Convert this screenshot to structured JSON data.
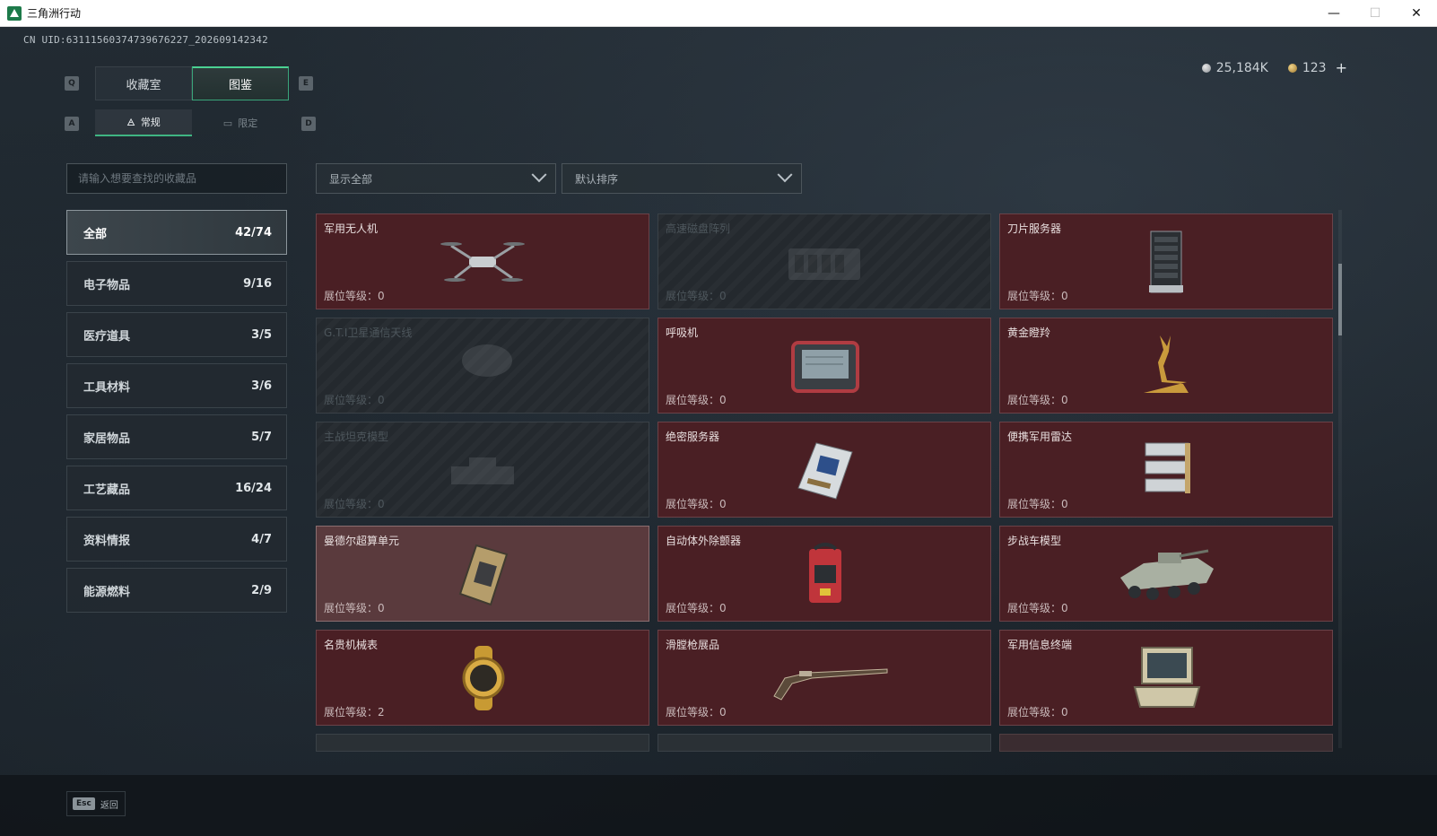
{
  "window": {
    "title": "三角洲行动",
    "minimize": "—",
    "maximize": "☐",
    "close": "✕"
  },
  "uid": "CN UID:6311156037473967622​7_202609142342",
  "currency": {
    "silver": "25,184K",
    "gold": "123",
    "plus": "+"
  },
  "keys": {
    "tab_left": "Q",
    "tab_right": "E",
    "sub_left": "A",
    "sub_right": "D"
  },
  "main_tabs": [
    {
      "label": "收藏室"
    },
    {
      "label": "图鉴"
    }
  ],
  "sub_tabs": [
    {
      "label": "常规",
      "icon": "🜁"
    },
    {
      "label": "限定",
      "icon": "▭"
    }
  ],
  "search": {
    "placeholder": "请输入想要查找的收藏品"
  },
  "filters": {
    "show": "显示全部",
    "sort": "默认排序"
  },
  "categories": [
    {
      "name": "全部",
      "count": "42/74"
    },
    {
      "name": "电子物品",
      "count": "9/16"
    },
    {
      "name": "医疗道具",
      "count": "3/5"
    },
    {
      "name": "工具材料",
      "count": "3/6"
    },
    {
      "name": "家居物品",
      "count": "5/7"
    },
    {
      "name": "工艺藏品",
      "count": "16/24"
    },
    {
      "name": "资料情报",
      "count": "4/7"
    },
    {
      "name": "能源燃料",
      "count": "2/9"
    }
  ],
  "items": [
    {
      "name": "军用无人机",
      "level": "展位等级：0",
      "locked": false
    },
    {
      "name": "高速磁盘阵列",
      "level": "展位等级：0",
      "locked": true
    },
    {
      "name": "刀片服务器",
      "level": "展位等级：0",
      "locked": false
    },
    {
      "name": "G.T.I卫星通信天线",
      "level": "展位等级：0",
      "locked": true
    },
    {
      "name": "呼吸机",
      "level": "展位等级：0",
      "locked": false
    },
    {
      "name": "黄金瞪羚",
      "level": "展位等级：0",
      "locked": false
    },
    {
      "name": "主战坦克模型",
      "level": "展位等级：0",
      "locked": true
    },
    {
      "name": "绝密服务器",
      "level": "展位等级：0",
      "locked": false
    },
    {
      "name": "便携军用雷达",
      "level": "展位等级：0",
      "locked": false
    },
    {
      "name": "曼德尔超算单元",
      "level": "展位等级：0",
      "locked": false
    },
    {
      "name": "自动体外除颤器",
      "level": "展位等级：0",
      "locked": false
    },
    {
      "name": "步战车模型",
      "level": "展位等级：0",
      "locked": false
    },
    {
      "name": "名贵机械表",
      "level": "展位等级：2",
      "locked": false
    },
    {
      "name": "滑膛枪展品",
      "level": "展位等级：0",
      "locked": false
    },
    {
      "name": "军用信息终端",
      "level": "展位等级：0",
      "locked": false
    }
  ],
  "bottom": {
    "esc": "Esc",
    "back": "返回"
  }
}
